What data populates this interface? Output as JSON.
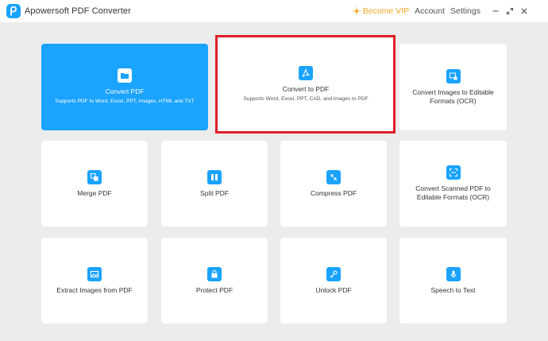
{
  "app": {
    "title": "Apowersoft PDF Converter"
  },
  "titlebar": {
    "vip_label": "Become VIP",
    "account_label": "Account",
    "settings_label": "Settings"
  },
  "colors": {
    "accent": "#1aa3ff",
    "vip": "#f5a623",
    "highlight": "#e0202a",
    "background": "#ececec"
  },
  "cards": {
    "convert_pdf": {
      "label": "Convert PDF",
      "sub": "Supports PDF to Word, Excel, PPT, Images, HTML and TXT",
      "icon": "folder-icon"
    },
    "convert_to_pdf": {
      "label": "Convert to PDF",
      "sub": "Supports Word, Excel, PPT, CAD, and images to PDF",
      "icon": "pdf-icon"
    },
    "images_ocr": {
      "label_line1": "Convert Images to Editable",
      "label_line2": "Formats (OCR)",
      "icon": "image-ocr-icon"
    },
    "merge": {
      "label": "Merge PDF",
      "icon": "merge-icon"
    },
    "split": {
      "label": "Split PDF",
      "icon": "split-icon"
    },
    "compress": {
      "label": "Compress PDF",
      "icon": "compress-icon"
    },
    "scanned_ocr": {
      "label_line1": "Convert Scanned PDF to",
      "label_line2": "Editable Formats (OCR)",
      "icon": "scan-icon"
    },
    "extract_images": {
      "label": "Extract Images from PDF",
      "icon": "image-icon"
    },
    "protect": {
      "label": "Protect PDF",
      "icon": "lock-icon"
    },
    "unlock": {
      "label": "Unlock PDF",
      "icon": "key-icon"
    },
    "speech": {
      "label": "Speech to Text",
      "icon": "microphone-icon"
    }
  }
}
